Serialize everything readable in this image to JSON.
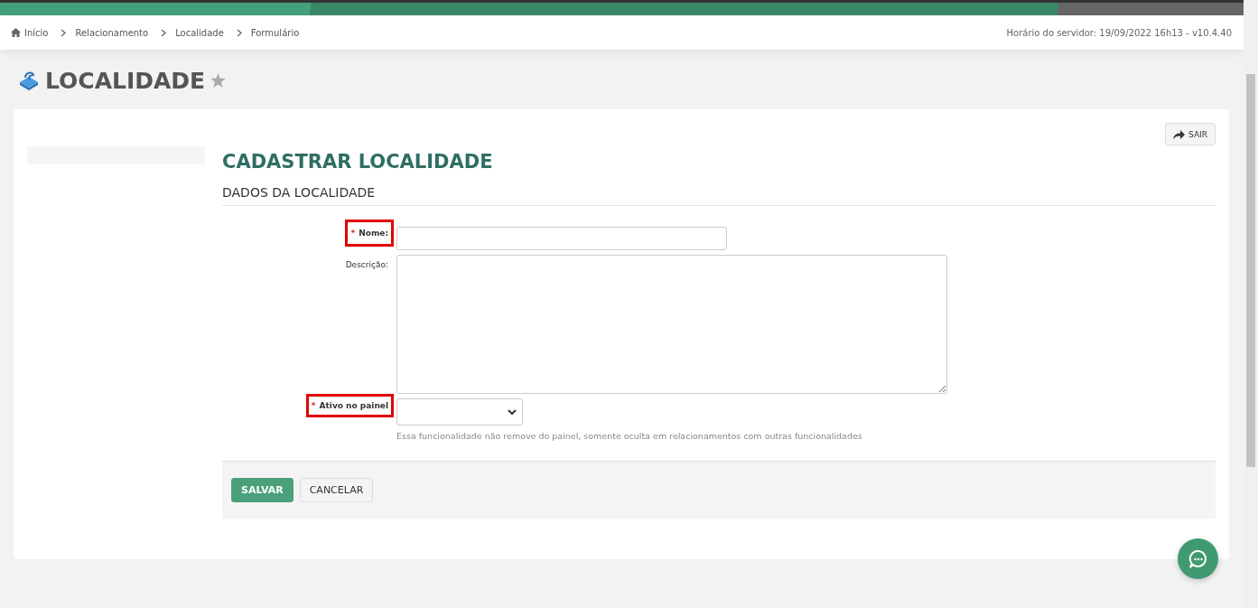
{
  "breadcrumb": [
    "Início",
    "Relacionamento",
    "Localidade",
    "Formulário"
  ],
  "server_info": "Horário do servidor: 19/09/2022 16h13 - v10.4.40",
  "page_title": "LOCALIDADE",
  "favorite": false,
  "exit_button": "SAIR",
  "form_title": "CADASTRAR LOCALIDADE",
  "section_title": "DADOS DA LOCALIDADE",
  "required_marker": "*",
  "fields": [
    {
      "kind": "text",
      "label": "Nome:",
      "required": true,
      "highlighted": true
    },
    {
      "kind": "textarea",
      "label": "Descrição:",
      "required": false,
      "highlighted": false
    },
    {
      "kind": "select",
      "label": "Ativo no painel",
      "required": true,
      "highlighted": true,
      "help": "Essa funcionalidade não remove do painel, somente oculta em relacionamentos com outras funcionalidades"
    }
  ],
  "buttons": [
    {
      "label": "SALVAR",
      "kind": "primary"
    },
    {
      "label": "CANCELAR",
      "kind": "secondary"
    }
  ]
}
